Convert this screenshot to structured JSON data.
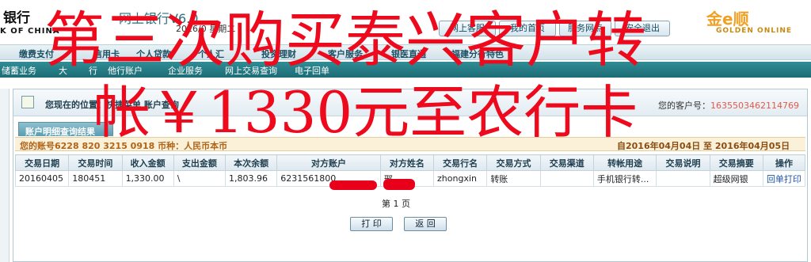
{
  "header": {
    "bank_name": "银行",
    "bank_name_en": "K OF CHINA",
    "system_title": "网上银行V6.0",
    "date_text": "2016/0 星期二",
    "buttons": [
      "网上客服",
      "我的首页",
      "服务网点",
      "安全退出"
    ],
    "partner_logo": "金e顺",
    "partner_logo_en": "GOLDEN ONLINE"
  },
  "menu": {
    "items": [
      "缴费支付",
      "信用卡",
      "个人贷款",
      "个人汇",
      "投资理财",
      "客户服务",
      "银医直通",
      "福建分行特色"
    ]
  },
  "submenu": {
    "items": [
      "储蓄业务",
      "大",
      "行",
      "他行账户",
      "企业服务",
      "网上交易查询",
      "电子回单"
    ]
  },
  "panel": {
    "title": "您现在的位置：快捷菜单 账户查询",
    "customer_label": "您的客户号：",
    "customer_no": "1635503462114769",
    "tab_label": "账户明细查询结果",
    "account_line": "您的账号6228 820 3215 0918 币种：人民币本币",
    "date_range": "自2016年04月04日 至 2016年04月05日"
  },
  "table": {
    "headers": [
      "交易日期",
      "交易时间",
      "收入金额",
      "支出金额",
      "本次余额",
      "对方账户",
      "对方姓名",
      "交易行名",
      "交易方式",
      "交易渠道",
      "转帐用途",
      "交易说明",
      "交易摘要",
      "操作"
    ],
    "rows": [
      [
        "20160405",
        "180451",
        "1,330.00",
        "\\",
        "1,803.96",
        "6231561800",
        "邢",
        "zhongxin",
        "转账",
        "",
        "手机银行转...",
        "",
        "超级网银",
        "回单打印"
      ]
    ]
  },
  "pagination": {
    "page_label": "第 1 页"
  },
  "actions": {
    "print_label": "打 印",
    "back_label": "返 回"
  },
  "overlay": {
    "line1": "第三次购买泰兴客户转",
    "line2": "帐￥1330元至农行卡"
  },
  "colors": {
    "overlay_red": "#ee0a1d",
    "teal_bar": "#1d6b74",
    "redaction": "#e8001b"
  }
}
